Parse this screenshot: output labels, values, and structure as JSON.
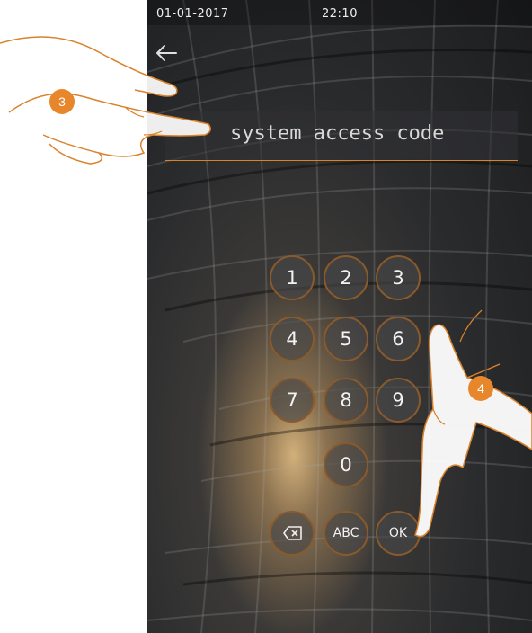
{
  "status_bar": {
    "date": "01-01-2017",
    "time": "22:10"
  },
  "nav": {
    "back_icon": "arrow-left-icon"
  },
  "code_input": {
    "placeholder": "system access code"
  },
  "keypad": {
    "digits": [
      "1",
      "2",
      "3",
      "4",
      "5",
      "6",
      "7",
      "8",
      "9",
      "0"
    ],
    "backspace_icon": "backspace-icon",
    "abc_label": "ABC",
    "ok_label": "OK"
  },
  "callouts": {
    "step_3": "3",
    "step_4": "4"
  },
  "colors": {
    "accent": "#e8862c",
    "key_border": "#8b5a2b",
    "input_underline": "#d9822b"
  }
}
